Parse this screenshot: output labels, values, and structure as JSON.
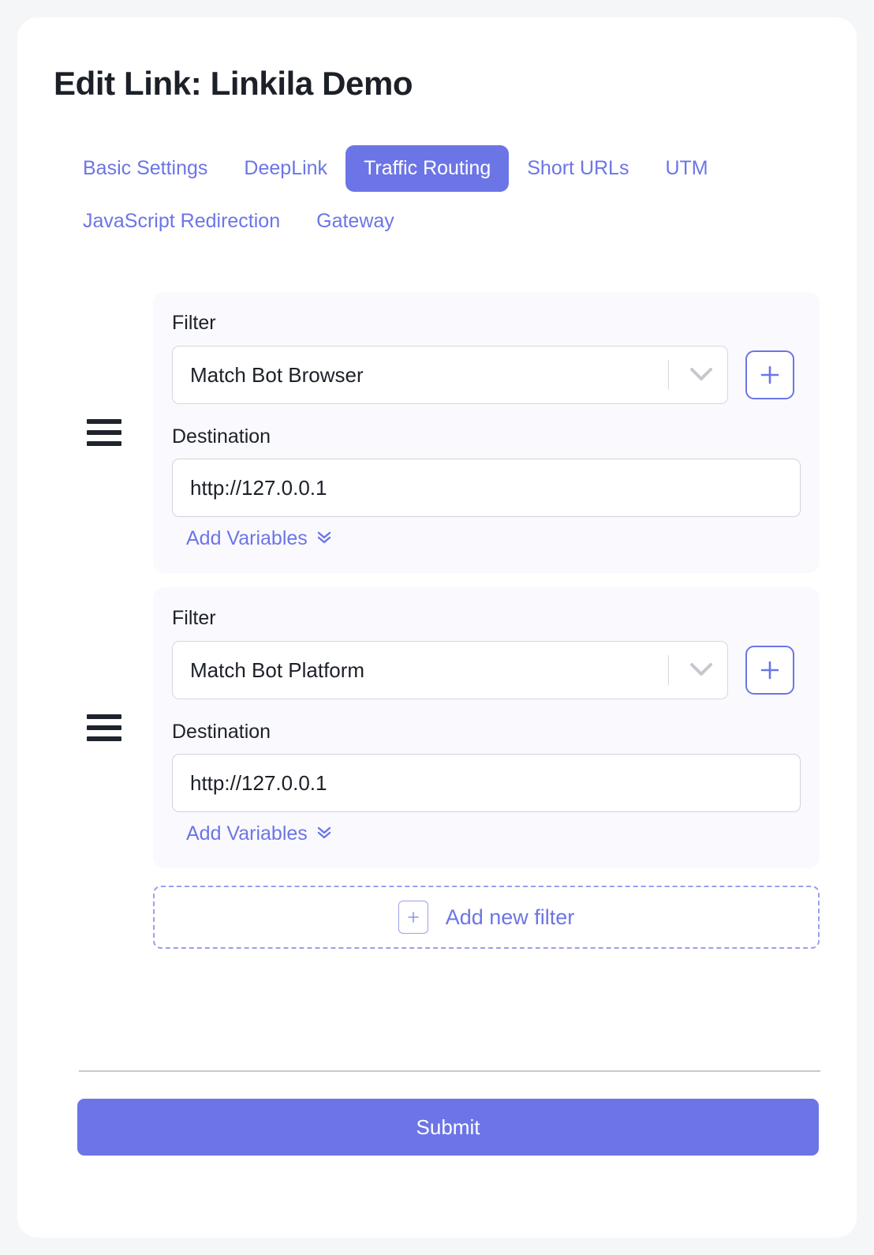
{
  "page": {
    "title": "Edit Link: Linkila Demo",
    "accent_color": "#6c75e6",
    "card_background": "#fafafe",
    "body_background": "#f5f6f8"
  },
  "tabs": [
    {
      "label": "Basic Settings",
      "active": false
    },
    {
      "label": "DeepLink",
      "active": false
    },
    {
      "label": "Traffic Routing",
      "active": true
    },
    {
      "label": "Short URLs",
      "active": false
    },
    {
      "label": "UTM",
      "active": false
    },
    {
      "label": "JavaScript Redirection",
      "active": false
    },
    {
      "label": "Gateway",
      "active": false
    }
  ],
  "routing": {
    "filter_label": "Filter",
    "destination_label": "Destination",
    "add_variables_label": "Add Variables",
    "add_variables_icon": "double-chevron-down-icon",
    "select_chevron_icon": "chevron-down-icon",
    "add_filter_icon": "plus-icon",
    "drag_handle_icon": "drag-handle-icon",
    "rows": [
      {
        "filter_label": "Filter",
        "filter_value": "Match Bot Browser",
        "destination_label": "Destination",
        "destination_value": "http://127.0.0.1",
        "destination_placeholder": "http://127.0.0.1",
        "add_variables_label": "Add Variables"
      },
      {
        "filter_label": "Filter",
        "filter_value": "Match Bot Platform",
        "destination_label": "Destination",
        "destination_value": "http://127.0.0.1",
        "destination_placeholder": "http://127.0.0.1",
        "add_variables_label": "Add Variables"
      }
    ],
    "add_new_filter_label": "Add new filter"
  },
  "footer": {
    "submit_label": "Submit"
  }
}
